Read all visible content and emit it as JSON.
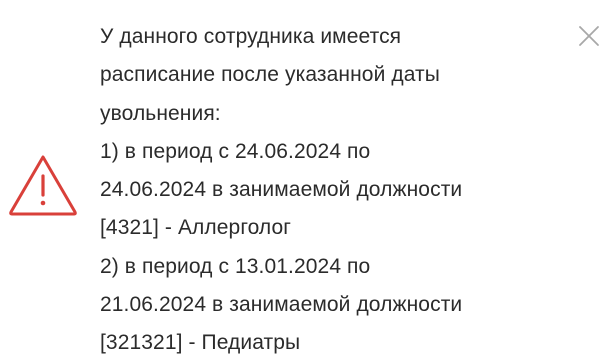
{
  "notification": {
    "lines": [
      "У данного сотрудника имеется",
      "расписание после указанной даты",
      "увольнения:",
      "1) в период с 24.06.2024 по",
      "24.06.2024 в занимаемой должности",
      "[4321] - Аллерголог",
      "2) в период с 13.01.2024 по",
      "21.06.2024 в занимаемой должности",
      "[321321] - Педиатры"
    ],
    "icon": "warning-triangle-icon",
    "close_icon": "close-icon",
    "colors": {
      "warning": "#d9403a",
      "close": "#a8a8a8",
      "text": "#2b2b2b",
      "background": "#ffffff"
    }
  }
}
